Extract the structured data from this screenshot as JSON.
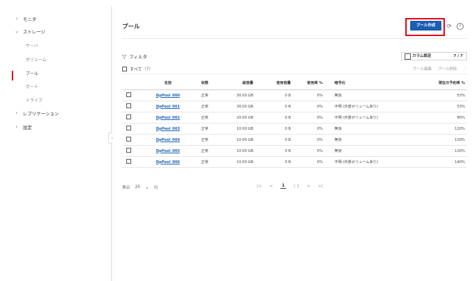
{
  "sidebar": {
    "items": [
      {
        "label": "モニタ",
        "chevron": "›"
      },
      {
        "label": "ストレージ",
        "chevron": "⌄"
      },
      {
        "label": "レプリケーション",
        "chevron": "›"
      },
      {
        "label": "設定",
        "chevron": "›"
      }
    ],
    "storage_sub": [
      {
        "label": "サーバ"
      },
      {
        "label": "ボリューム"
      },
      {
        "label": "プール"
      },
      {
        "label": "ポート"
      },
      {
        "label": "ドライブ"
      }
    ],
    "collapse_icon": "‹"
  },
  "header": {
    "title": "プール",
    "create_label": "プール作成",
    "refresh_icon": "⟳",
    "help_icon": "?"
  },
  "toolbar": {
    "filter_label": "フィルタ",
    "filter_icon": "▽",
    "column_settings_label": "カラム設定",
    "column_count": "7 / 7",
    "select_all_label": "すべて",
    "select_count": "(7)",
    "edit_label": "プール編集",
    "delete_label": "プール削除",
    "more_icon": "⋮"
  },
  "table": {
    "headers": [
      "名前",
      "状態",
      "総容量",
      "使用容量",
      "使用率 %",
      "暗号化",
      "現在の予約率 %"
    ],
    "rows": [
      {
        "name": "DpPool_000",
        "status": "正常",
        "total": "30.00 GB",
        "used": "0 B",
        "usage": "0%",
        "encryption": "無効",
        "reserve": "53%"
      },
      {
        "name": "DpPool_001",
        "status": "正常",
        "total": "30.00 GB",
        "used": "0 B",
        "usage": "0%",
        "encryption": "不明 (外部ボリュームあり)",
        "reserve": "53%"
      },
      {
        "name": "DpPool_002",
        "status": "正常",
        "total": "20.00 GB",
        "used": "0 B",
        "usage": "0%",
        "encryption": "不明 (外部ボリュームあり)",
        "reserve": "80%"
      },
      {
        "name": "DpPool_003",
        "status": "正常",
        "total": "10.00 GB",
        "used": "0 B",
        "usage": "0%",
        "encryption": "無効",
        "reserve": "120%"
      },
      {
        "name": "DpPool_004",
        "status": "正常",
        "total": "10.00 GB",
        "used": "0 B",
        "usage": "0%",
        "encryption": "無効",
        "reserve": "120%"
      },
      {
        "name": "DpPool_005",
        "status": "正常",
        "total": "10.00 GB",
        "used": "0 B",
        "usage": "0%",
        "encryption": "無効",
        "reserve": "120%"
      },
      {
        "name": "DpPool_006",
        "status": "正常",
        "total": "10.00 GB",
        "used": "0 B",
        "usage": "0%",
        "encryption": "不明 (外部ボリュームあり)",
        "reserve": "140%"
      }
    ]
  },
  "footer": {
    "show_label": "表示",
    "page_size": "25",
    "rows_label": "行",
    "dropdown_icon": "⌄",
    "page_first": "|<",
    "page_prev": "<",
    "page_current": "1",
    "page_total": "/ 1",
    "page_next": ">",
    "page_last": ">|"
  },
  "colors": {
    "accent": "#1a5fb4",
    "highlight": "#e60012"
  }
}
